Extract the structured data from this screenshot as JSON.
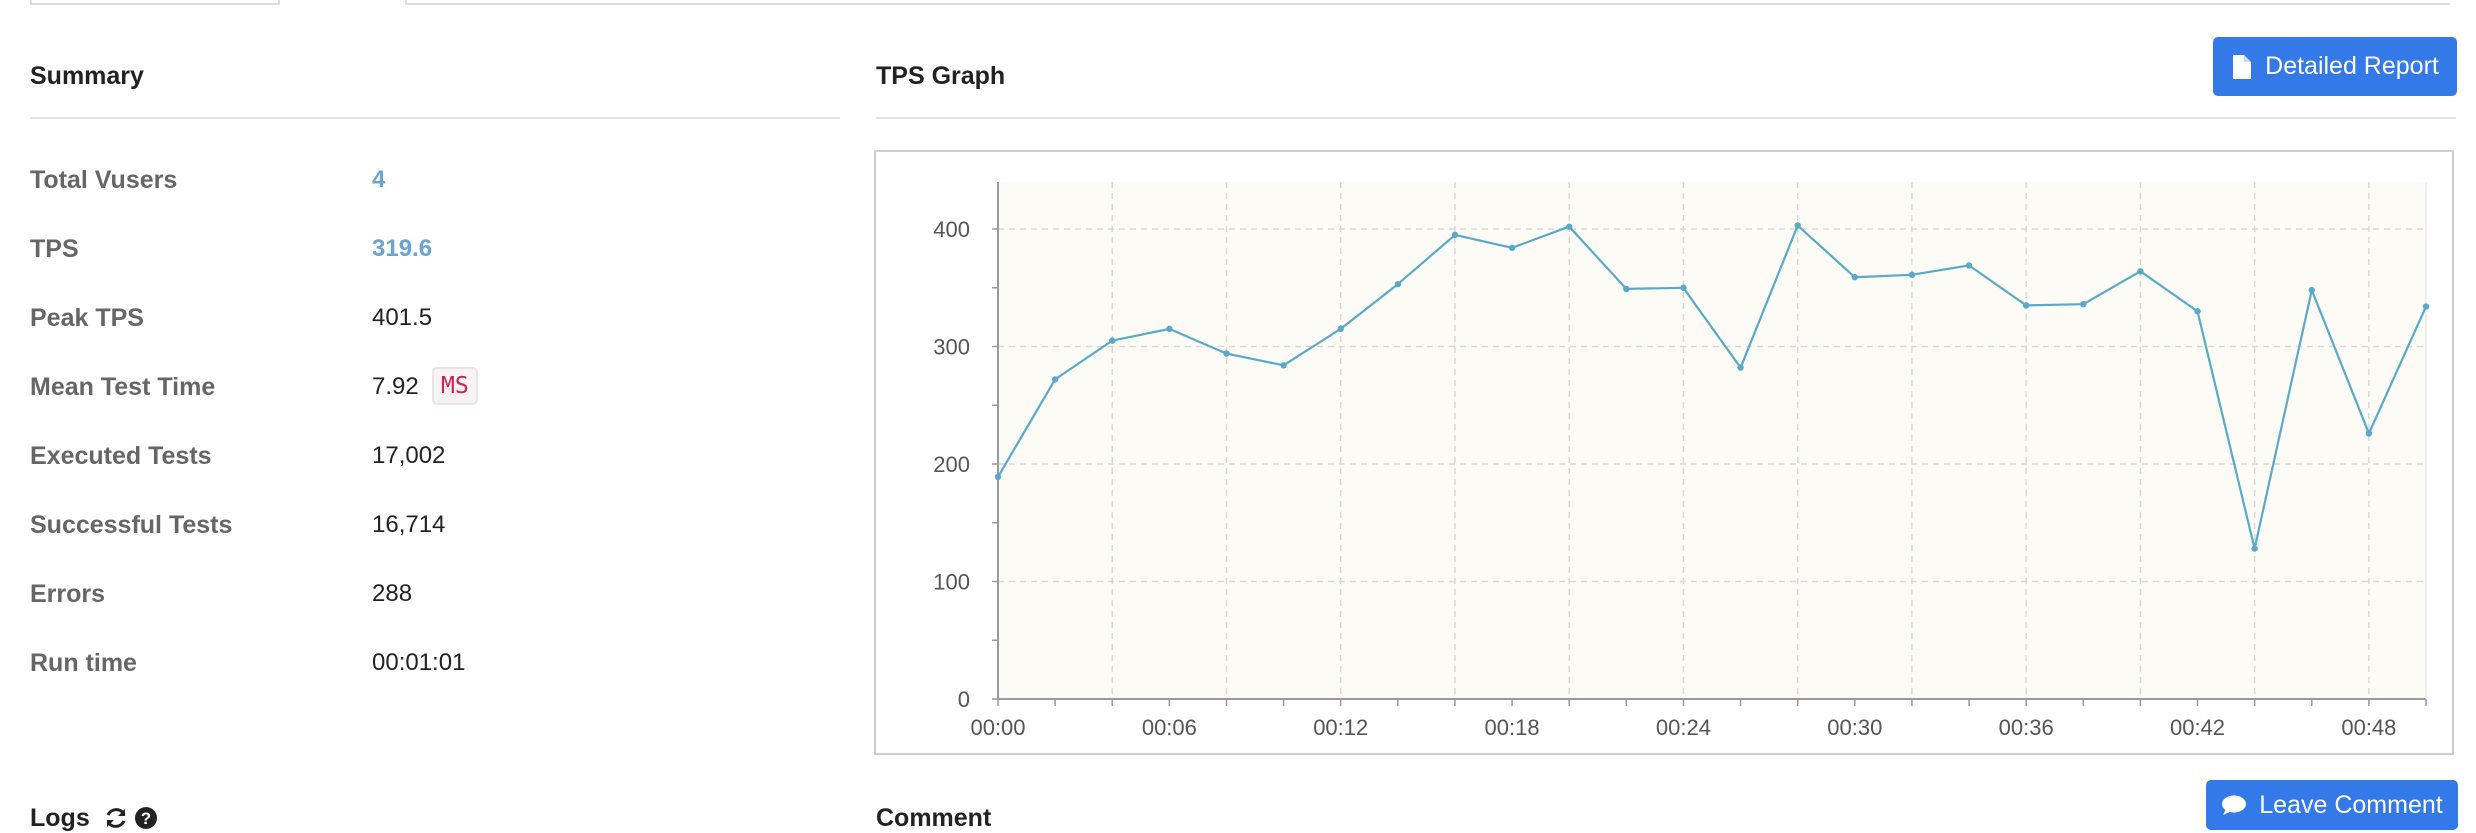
{
  "summary": {
    "title": "Summary",
    "rows": [
      {
        "label": "Total Vusers",
        "value": "4"
      },
      {
        "label": "TPS",
        "value": "319.6"
      },
      {
        "label": "Peak TPS",
        "value": "401.5"
      },
      {
        "label": "Mean Test Time",
        "value": "7.92",
        "unit": "MS"
      },
      {
        "label": "Executed Tests",
        "value": "17,002"
      },
      {
        "label": "Successful Tests",
        "value": "16,714"
      },
      {
        "label": "Errors",
        "value": "288"
      },
      {
        "label": "Run time",
        "value": "00:01:01"
      }
    ]
  },
  "graph": {
    "title": "TPS Graph",
    "report_button": "Detailed Report",
    "report_icon": "file-icon"
  },
  "logs": {
    "title": "Logs",
    "refresh_icon": "refresh-icon",
    "help_icon": "question-circle-icon"
  },
  "comment": {
    "title": "Comment",
    "button": "Leave Comment",
    "button_icon": "comment-icon"
  },
  "colors": {
    "accent": "#337ae8",
    "link_value": "#6aa4cf",
    "line": "#5aa9c8",
    "plot_bg": "#fcfbf6",
    "unit_text": "#c7254e"
  },
  "chart_data": {
    "type": "line",
    "title": "",
    "xlabel": "",
    "ylabel": "",
    "ylim": [
      0,
      440
    ],
    "y_ticks": [
      "0",
      "100",
      "200",
      "300",
      "400"
    ],
    "x_ticks": [
      "00:00",
      "00:06",
      "00:12",
      "00:18",
      "00:24",
      "00:30",
      "00:36",
      "00:42",
      "00:48"
    ],
    "grid": true,
    "series": [
      {
        "values": [
          189,
          272,
          305,
          315,
          294,
          284,
          315,
          353,
          395,
          384,
          402,
          349,
          350,
          282,
          403,
          359,
          361,
          369,
          335,
          336,
          364,
          330,
          128,
          348,
          226,
          334
        ]
      }
    ]
  }
}
